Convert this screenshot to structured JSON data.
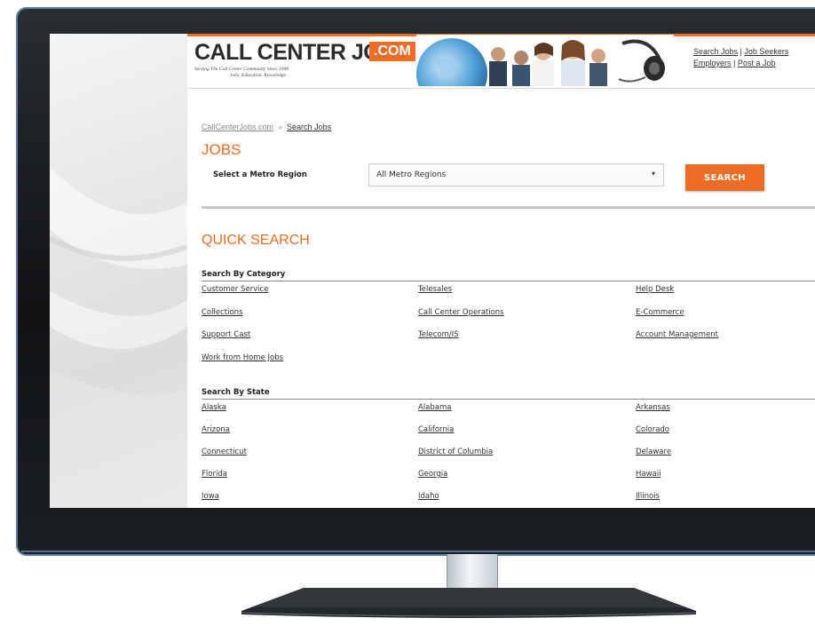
{
  "header": {
    "logo_main": "CALL CENTER JOBS",
    "logo_suffix": ".COM",
    "tagline_line1": "Serving The Call Center Community Since 1998",
    "tagline_line2": "Jobs. Education. Knowledge.",
    "links": {
      "search_jobs": "Search Jobs",
      "job_seekers": "Job Seekers",
      "employers": "Employers",
      "post_a_job": "Post a Job",
      "separator": "|"
    }
  },
  "breadcrumb": {
    "home": "CallCenterJobs.com",
    "separator": "»",
    "current": "Search Jobs"
  },
  "jobs": {
    "heading": "JOBS",
    "select_label": "Select a Metro Region",
    "select_value": "All Metro Regions",
    "select_arrow": "▾",
    "search_button": "SEARCH"
  },
  "quick_search": {
    "heading": "QUICK SEARCH",
    "category_label": "Search By Category",
    "categories": [
      "Customer Service",
      "Telesales",
      "Help Desk",
      "Collections",
      "Call Center Operations",
      "E-Commerce",
      "Support Cast",
      "Telecom/IS",
      "Account Management",
      "Work from Home Jobs"
    ],
    "state_label": "Search By State",
    "states": [
      "Alaska",
      "Alabama",
      "Arkansas",
      "Arizona",
      "California",
      "Colorado",
      "Connecticut",
      "District of Columbia",
      "Delaware",
      "Florida",
      "Georgia",
      "Hawaii",
      "Iowa",
      "Idaho",
      "Illinois"
    ]
  },
  "colors": {
    "accent": "#ef6c26",
    "text": "#333333",
    "bezel": "#16181b"
  }
}
